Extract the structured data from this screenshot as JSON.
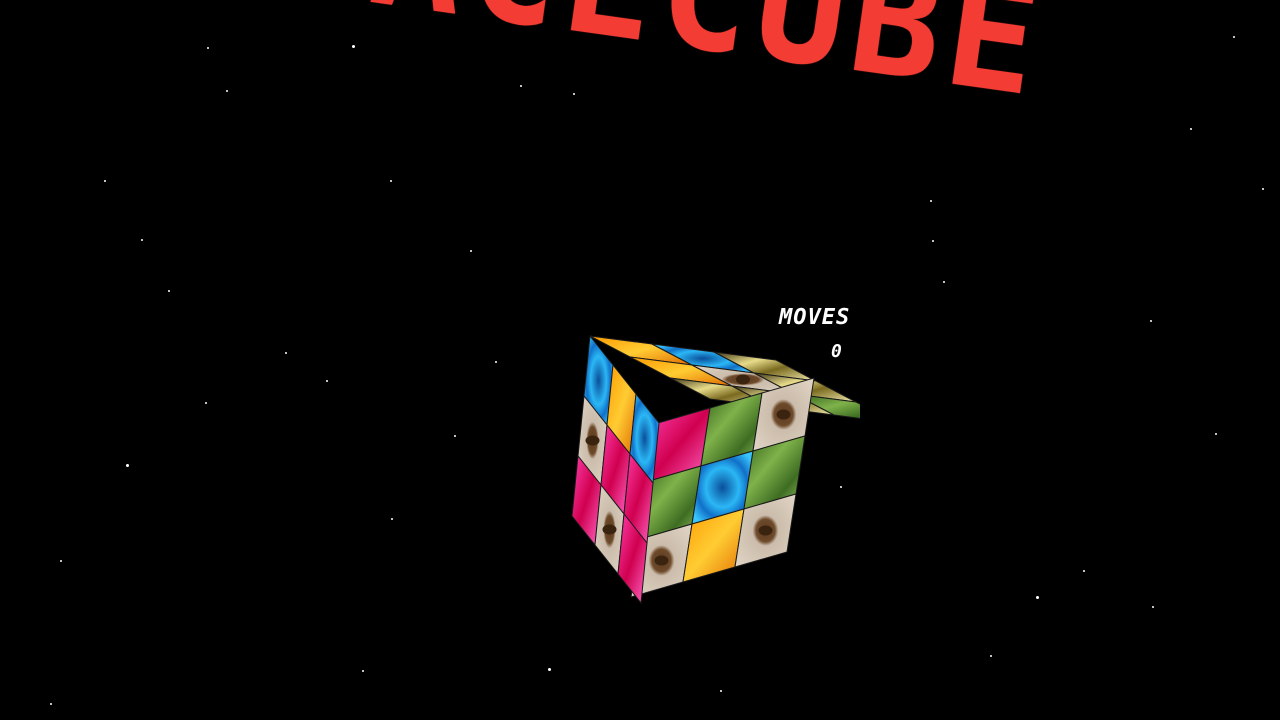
{
  "game": {
    "title": "FACECUBE",
    "moves_label": "MOVES",
    "moves_value": "0"
  },
  "colors": {
    "background": "#000000",
    "title": "#f23c34",
    "hud_text": "#ffffff"
  },
  "cube": {
    "textures": [
      "orange-swirl",
      "blue-swirl",
      "gold-metal",
      "dirt-beetle",
      "green-tree",
      "magenta-plasma"
    ],
    "top_face": [
      "orange-swirl",
      "orange-swirl",
      "gold-metal",
      "blue-swirl",
      "dirt-beetle",
      "gold-metal",
      "gold-metal",
      "gold-metal",
      "green-tree"
    ],
    "front_face": [
      "magenta-plasma",
      "green-tree",
      "dirt-beetle",
      "green-tree",
      "blue-swirl",
      "green-tree",
      "dirt-beetle",
      "orange-swirl",
      "dirt-beetle"
    ],
    "left_face": [
      "blue-swirl",
      "orange-swirl",
      "blue-swirl",
      "dirt-beetle",
      "magenta-plasma",
      "magenta-plasma",
      "magenta-plasma",
      "dirt-beetle",
      "magenta-plasma"
    ]
  }
}
